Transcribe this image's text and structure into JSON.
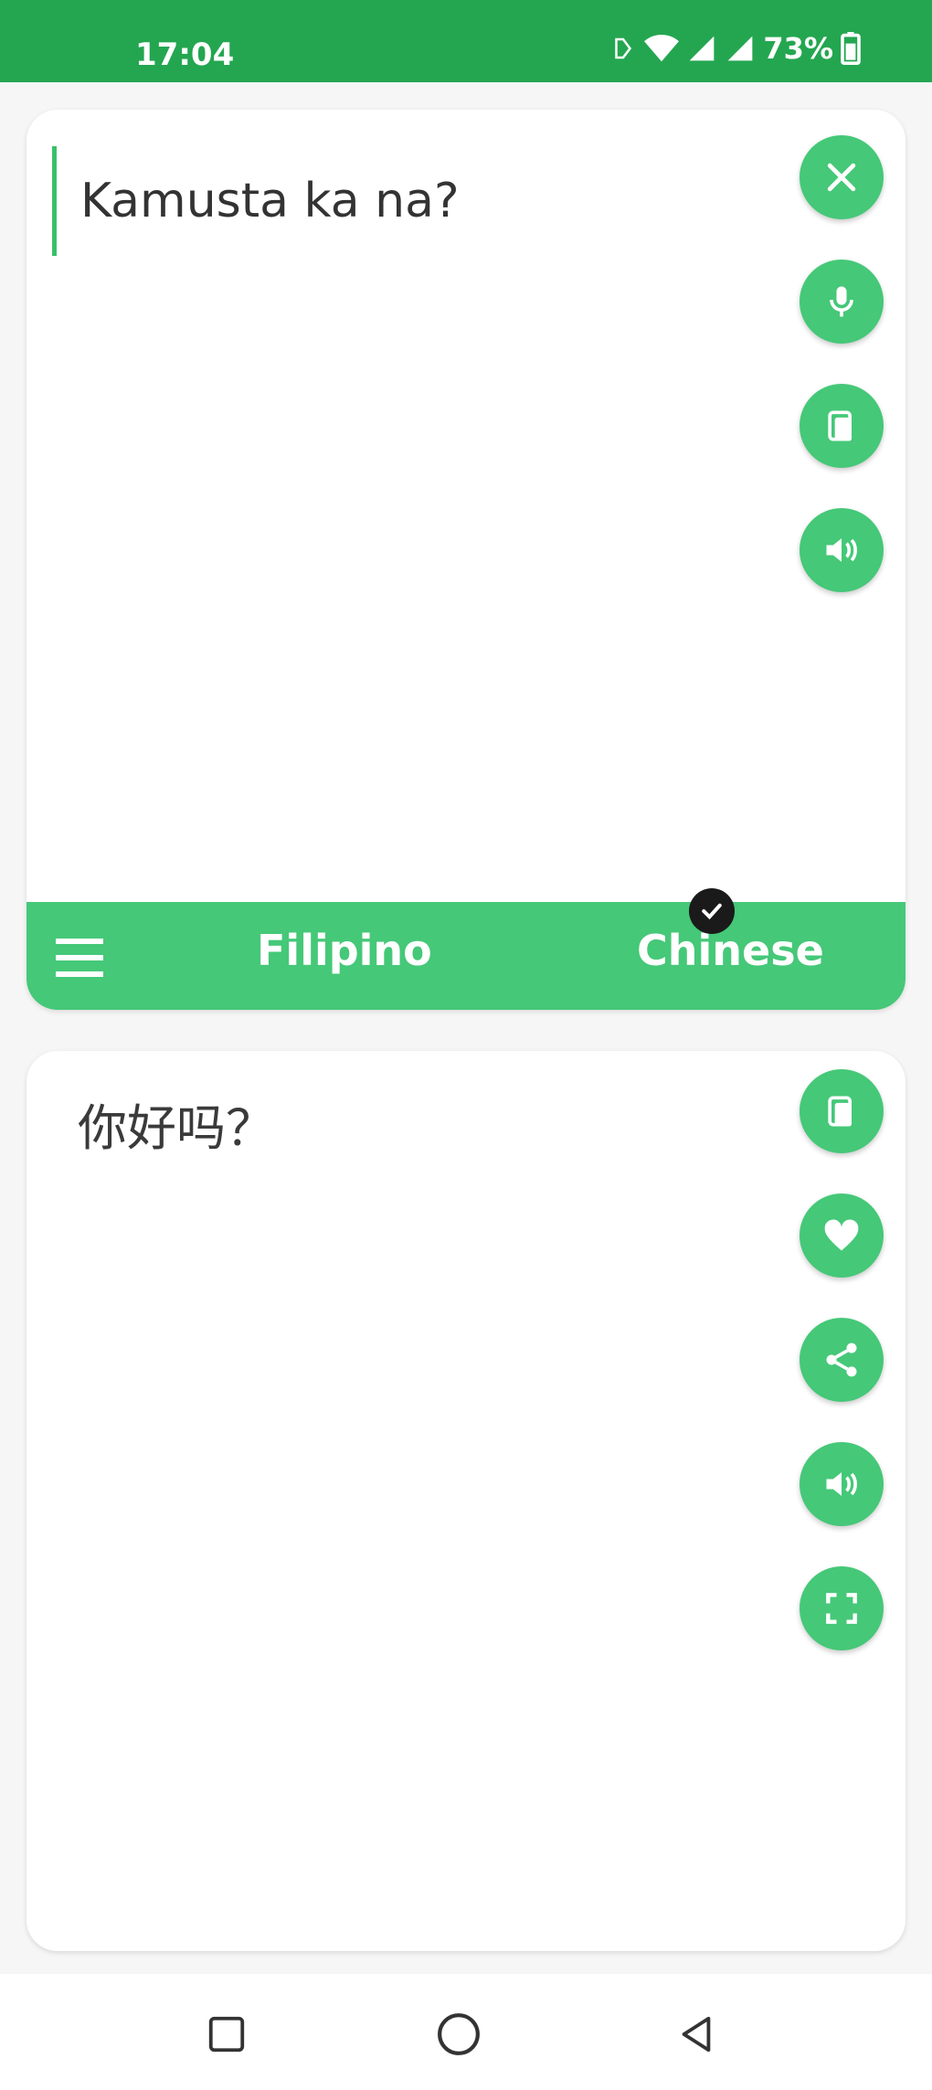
{
  "status_bar": {
    "time": "17:04",
    "battery_percent": "73%"
  },
  "source_panel": {
    "input_value": "Kamusta ka na?",
    "buttons": [
      "clear",
      "microphone",
      "paste",
      "speak"
    ]
  },
  "language_bar": {
    "source_language": "Filipino",
    "target_language": "Chinese"
  },
  "result_panel": {
    "translated_text": "你好吗？",
    "buttons": [
      "copy",
      "favorite",
      "share",
      "speak",
      "fullscreen"
    ]
  },
  "colors": {
    "status_green": "#24a650",
    "accent_green": "#45c878",
    "background": "#f6f6f6"
  },
  "icons": {
    "clear": "close-icon",
    "microphone": "microphone-icon",
    "paste": "clipboard-icon",
    "speak": "speaker-icon",
    "copy": "copy-icon",
    "favorite": "heart-icon",
    "share": "share-icon",
    "fullscreen": "fullscreen-icon",
    "menu": "menu-icon",
    "check": "check-icon"
  }
}
